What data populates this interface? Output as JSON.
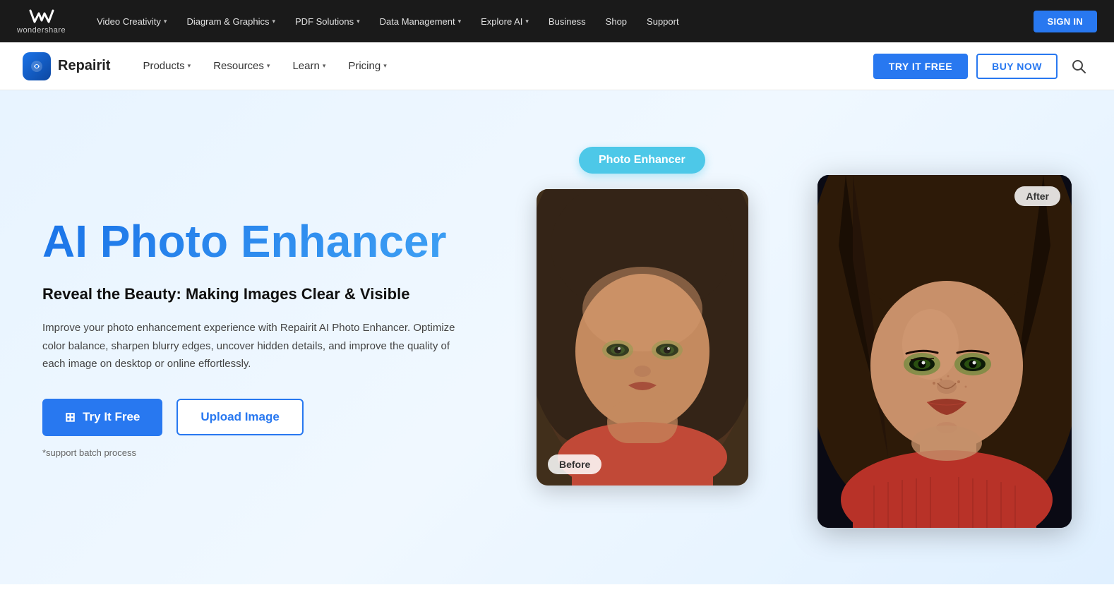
{
  "top_nav": {
    "logo_text": "wondershare",
    "items": [
      {
        "label": "Video Creativity",
        "has_dropdown": true
      },
      {
        "label": "Diagram & Graphics",
        "has_dropdown": true
      },
      {
        "label": "PDF Solutions",
        "has_dropdown": true
      },
      {
        "label": "Data Management",
        "has_dropdown": true
      },
      {
        "label": "Explore AI",
        "has_dropdown": true
      },
      {
        "label": "Business",
        "has_dropdown": false
      },
      {
        "label": "Shop",
        "has_dropdown": false
      },
      {
        "label": "Support",
        "has_dropdown": false
      }
    ],
    "sign_in": "SIGN IN"
  },
  "second_nav": {
    "brand_name": "Repairit",
    "items": [
      {
        "label": "Products",
        "has_dropdown": true
      },
      {
        "label": "Resources",
        "has_dropdown": true
      },
      {
        "label": "Learn",
        "has_dropdown": true
      },
      {
        "label": "Pricing",
        "has_dropdown": true
      }
    ],
    "try_free_label": "TRY IT FREE",
    "buy_now_label": "BUY NOW"
  },
  "hero": {
    "title": "AI Photo Enhancer",
    "subtitle": "Reveal the Beauty: Making Images Clear & Visible",
    "description": "Improve your photo enhancement experience with Repairit AI Photo Enhancer. Optimize color balance, sharpen blurry edges, uncover hidden details, and improve the quality of each image on desktop or online effortlessly.",
    "try_free_btn": "Try It Free",
    "upload_btn": "Upload Image",
    "batch_note": "*support batch process",
    "photo_enhancer_badge": "Photo Enhancer",
    "label_before": "Before",
    "label_after": "After"
  }
}
